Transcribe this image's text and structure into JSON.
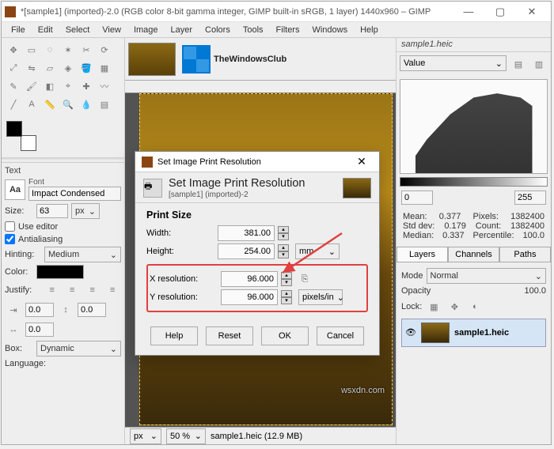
{
  "window": {
    "title": "*[sample1] (imported)-2.0 (RGB color 8-bit gamma integer, GIMP built-in sRGB, 1 layer) 1440x960 – GIMP",
    "min": "—",
    "max": "▢",
    "close": "✕"
  },
  "menu": [
    "File",
    "Edit",
    "Select",
    "View",
    "Image",
    "Layer",
    "Colors",
    "Tools",
    "Filters",
    "Windows",
    "Help"
  ],
  "logo_text": "TheWindowsClub",
  "left": {
    "text_hdr": "Text",
    "font_hdr": "Font",
    "font_name": "Impact Condensed",
    "size_lbl": "Size:",
    "size_val": "63",
    "size_unit": "px",
    "use_editor": "Use editor",
    "antialias": "Antialiasing",
    "hinting_lbl": "Hinting:",
    "hinting_val": "Medium",
    "color_lbl": "Color:",
    "justify_lbl": "Justify:",
    "spacing_a": "0.0",
    "spacing_b": "0.0",
    "spacing_c": "0.0",
    "box_lbl": "Box:",
    "box_val": "Dynamic",
    "lang_lbl": "Language:"
  },
  "status": {
    "unit": "px",
    "zoom": "50 %",
    "info": "sample1.heic (12.9 MB)"
  },
  "right": {
    "filename": "sample1.heic",
    "channel": "Value",
    "range_lo": "0",
    "range_hi": "255",
    "stats": {
      "mean_l": "Mean:",
      "mean_v": "0.377",
      "sd_l": "Std dev:",
      "sd_v": "0.179",
      "med_l": "Median:",
      "med_v": "0.337",
      "pix_l": "Pixels:",
      "pix_v": "1382400",
      "cnt_l": "Count:",
      "cnt_v": "1382400",
      "pct_l": "Percentile:",
      "pct_v": "100.0"
    },
    "tabs": [
      "Layers",
      "Channels",
      "Paths"
    ],
    "mode_lbl": "Mode",
    "mode_val": "Normal",
    "op_lbl": "Opacity",
    "op_val": "100.0",
    "lock_lbl": "Lock:",
    "layer_name": "sample1.heic"
  },
  "dialog": {
    "title": "Set Image Print Resolution",
    "heading": "Set Image Print Resolution",
    "sub": "[sample1] (imported)-2",
    "section": "Print Size",
    "width_lbl": "Width:",
    "width_val": "381.00",
    "height_lbl": "Height:",
    "height_val": "254.00",
    "size_unit": "mm",
    "xres_lbl": "X resolution:",
    "xres_val": "96.000",
    "yres_lbl": "Y resolution:",
    "yres_val": "96.000",
    "res_unit": "pixels/in",
    "btns": {
      "help": "Help",
      "reset": "Reset",
      "ok": "OK",
      "cancel": "Cancel"
    }
  },
  "watermark": "wsxdn.com"
}
